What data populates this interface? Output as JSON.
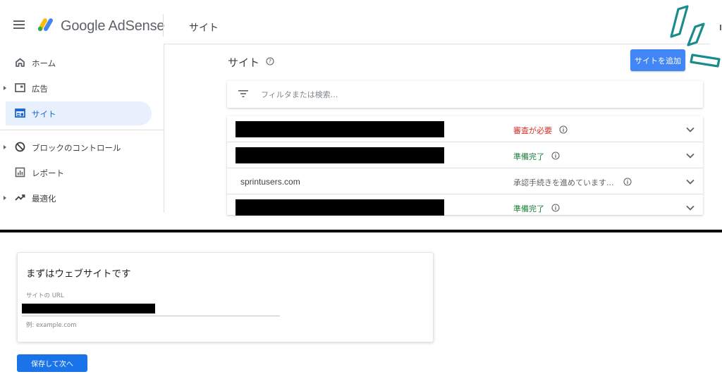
{
  "app": {
    "brand": "Google AdSense",
    "page_title": "サイト"
  },
  "sidebar": {
    "items": [
      {
        "label": "ホーム",
        "icon": "home-icon",
        "expandable": false,
        "active": false
      },
      {
        "label": "広告",
        "icon": "ad-unit-icon",
        "expandable": true,
        "active": false
      },
      {
        "label": "サイト",
        "icon": "site-icon",
        "expandable": false,
        "active": true
      },
      {
        "label": "ブロックのコントロール",
        "icon": "block-icon",
        "expandable": true,
        "active": false
      },
      {
        "label": "レポート",
        "icon": "report-icon",
        "expandable": false,
        "active": false
      },
      {
        "label": "最適化",
        "icon": "trending-up-icon",
        "expandable": true,
        "active": false
      }
    ]
  },
  "main": {
    "title": "サイト",
    "add_button": "サイトを追加",
    "filter_placeholder": "フィルタまたは検索...",
    "sites": [
      {
        "name": "",
        "redacted": true,
        "status": "審査が必要",
        "status_color": "#d93025"
      },
      {
        "name": "",
        "redacted": true,
        "status": "準備完了",
        "status_color": "#188038"
      },
      {
        "name": "sprintusers.com",
        "redacted": false,
        "status": "承認手続きを進めています...",
        "status_color": "#5f6368"
      },
      {
        "name": "",
        "redacted": true,
        "status": "準備完了",
        "status_color": "#188038"
      }
    ]
  },
  "form": {
    "title": "まずはウェブサイトです",
    "url_label": "サイトの URL",
    "url_value": "",
    "url_hint": "例: example.com",
    "save_button": "保存して次へ"
  },
  "colors": {
    "primary": "#1a73e8",
    "add_button": "#4285f4",
    "active_nav_bg": "#e8f0fe",
    "status_review": "#d93025",
    "status_ready": "#188038",
    "status_pending": "#5f6368",
    "annotation_teal": "#1a8c8c"
  }
}
